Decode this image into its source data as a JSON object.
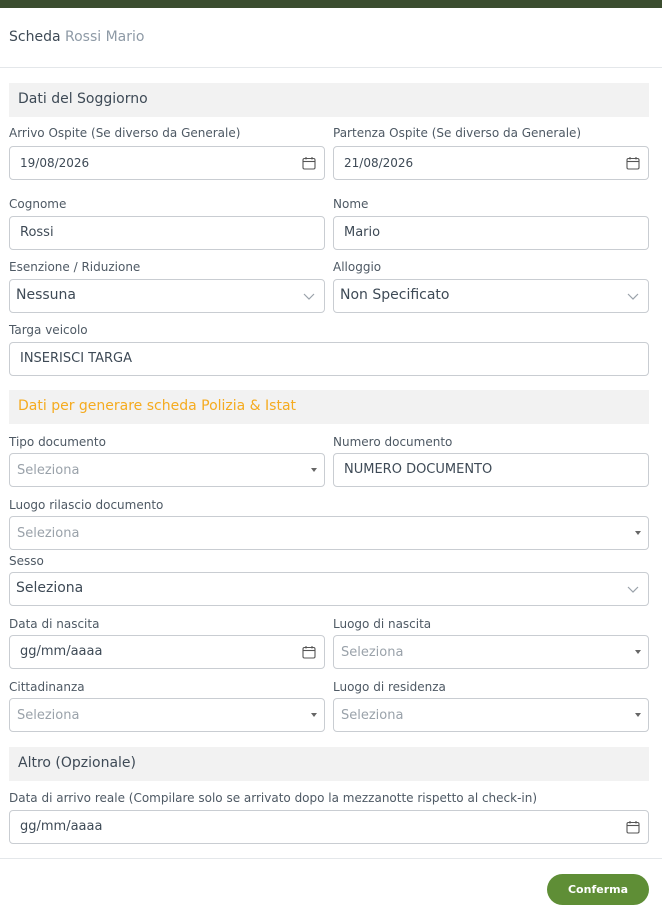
{
  "header": {
    "title_prefix": "Scheda",
    "guest_name": "Rossi Mario"
  },
  "sections": {
    "stay": "Dati del Soggiorno",
    "police": "Dati per generare scheda Polizia & Istat",
    "other": "Altro (Opzionale)"
  },
  "stay": {
    "arrival_label": "Arrivo Ospite (Se diverso da Generale)",
    "arrival_value": "19/08/2026",
    "departure_label": "Partenza Ospite (Se diverso da Generale)",
    "departure_value": "21/08/2026",
    "surname_label": "Cognome",
    "surname_value": "Rossi",
    "name_label": "Nome",
    "name_value": "Mario",
    "exemption_label": "Esenzione / Riduzione",
    "exemption_value": "Nessuna",
    "lodging_label": "Alloggio",
    "lodging_value": "Non Specificato",
    "plate_label": "Targa veicolo",
    "plate_value": "INSERISCI TARGA"
  },
  "police": {
    "doc_type_label": "Tipo documento",
    "doc_type_value": "Seleziona",
    "doc_number_label": "Numero documento",
    "doc_number_value": "NUMERO DOCUMENTO",
    "doc_place_label": "Luogo rilascio documento",
    "doc_place_value": "Seleziona",
    "sex_label": "Sesso",
    "sex_value": "Seleziona",
    "birth_date_label": "Data di nascita",
    "birth_date_value": "gg/mm/aaaa",
    "birth_place_label": "Luogo di nascita",
    "birth_place_value": "Seleziona",
    "citizenship_label": "Cittadinanza",
    "citizenship_value": "Seleziona",
    "residence_label": "Luogo di residenza",
    "residence_value": "Seleziona"
  },
  "other": {
    "real_arrival_label": "Data di arrivo reale (Compilare solo se arrivato dopo la mezzanotte rispetto al check-in)",
    "real_arrival_value": "gg/mm/aaaa"
  },
  "footer": {
    "confirm_label": "Conferma"
  },
  "colors": {
    "accent": "#f5ab1f",
    "confirm": "#5f8e36",
    "topbar": "#3b4d2f"
  },
  "icons": {
    "date": "calendar-icon",
    "select": "chevron-down-icon",
    "select2": "caret-down-icon"
  }
}
